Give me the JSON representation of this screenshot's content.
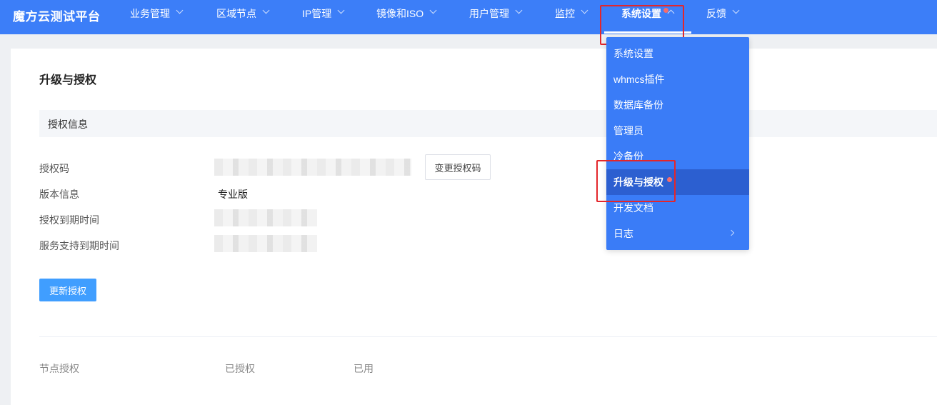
{
  "brand": "魔方云测试平台",
  "nav": [
    {
      "label": "业务管理"
    },
    {
      "label": "区域节点"
    },
    {
      "label": "IP管理"
    },
    {
      "label": "镜像和ISO"
    },
    {
      "label": "用户管理"
    },
    {
      "label": "监控"
    },
    {
      "label": "系统设置"
    },
    {
      "label": "反馈"
    }
  ],
  "page": {
    "title": "升级与授权",
    "section_title": "授权信息",
    "rows": {
      "license_code_label": "授权码",
      "version_label": "版本信息",
      "version_value": "专业版",
      "license_expiry_label": "授权到期时间",
      "support_expiry_label": "服务支持到期时间"
    },
    "change_code_button": "变更授权码",
    "update_button": "更新授权",
    "footer": {
      "node_license": "节点授权",
      "licensed": "已授权",
      "used": "已用"
    }
  },
  "dropdown": {
    "items": [
      {
        "label": "系统设置"
      },
      {
        "label": "whmcs插件"
      },
      {
        "label": "数据库备份"
      },
      {
        "label": "管理员"
      },
      {
        "label": "冷备份"
      },
      {
        "label": "升级与授权"
      },
      {
        "label": "开发文档"
      },
      {
        "label": "日志"
      }
    ]
  },
  "colors": {
    "nav_bg": "#3c7ef8",
    "dropdown_bg": "#3a7cf7",
    "dropdown_active_bg": "#2c5fd0",
    "primary_button": "#409eff",
    "highlight_border": "#e3262b",
    "notice_dot": "#f56c6c"
  }
}
